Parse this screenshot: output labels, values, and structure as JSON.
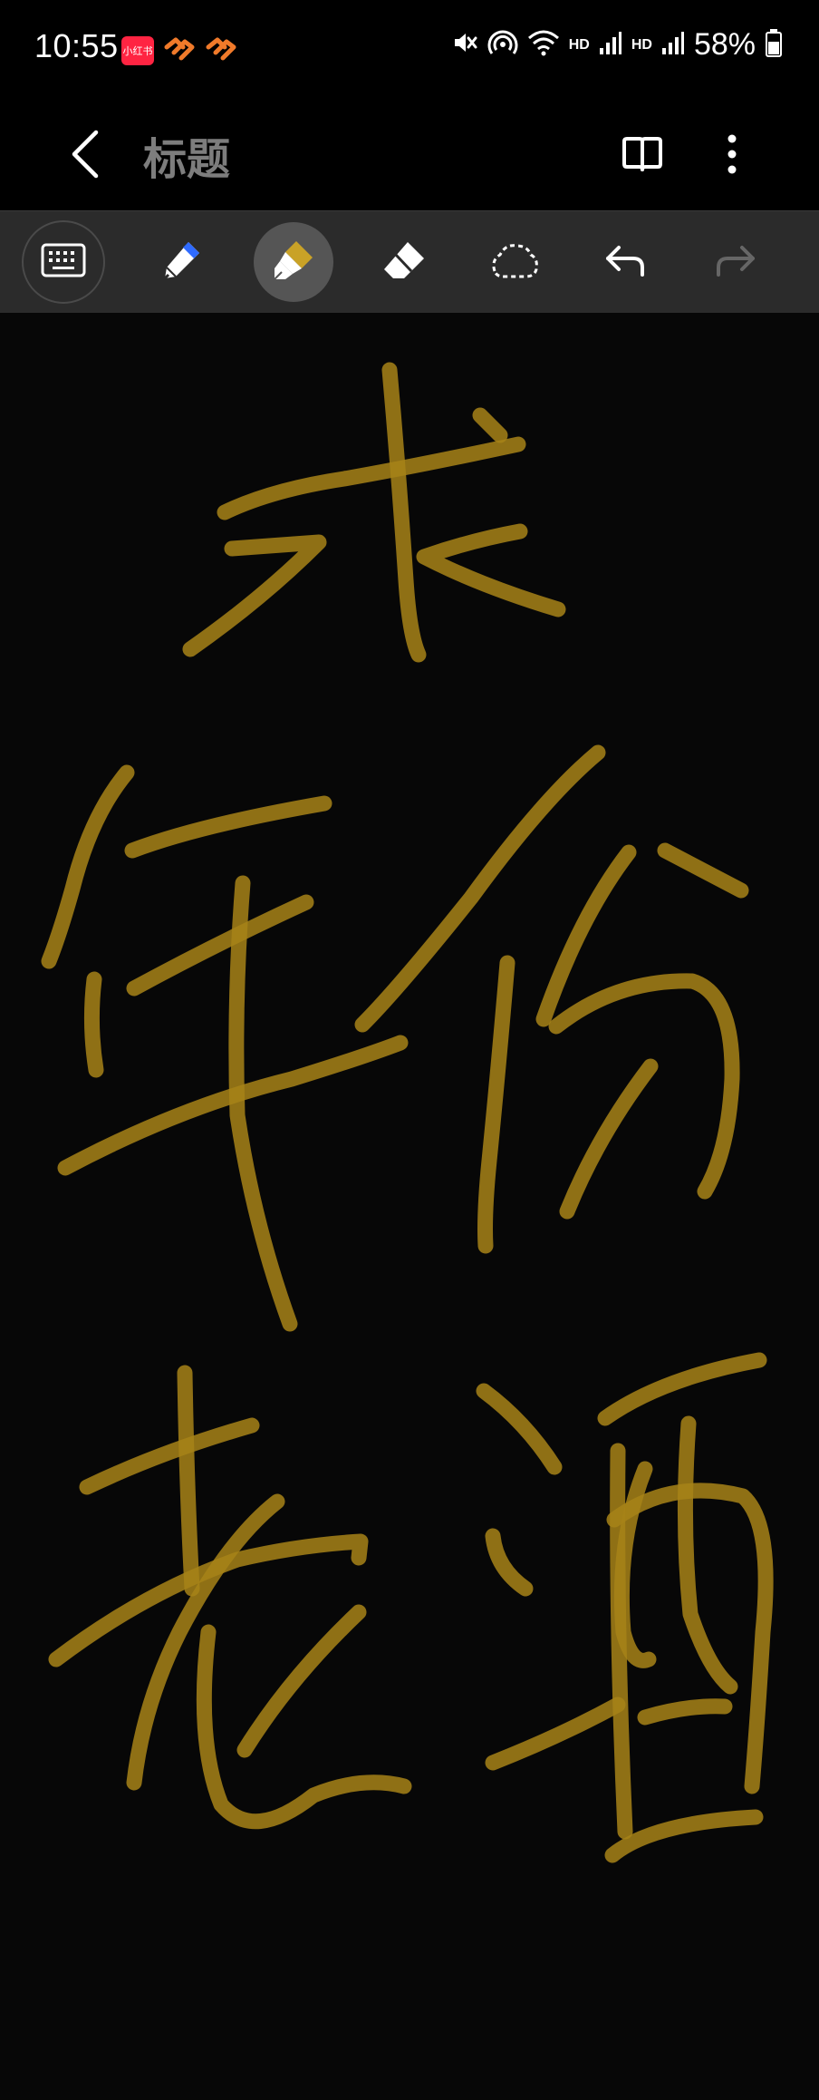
{
  "status_bar": {
    "time": "10:55",
    "notif_badge": "小红书",
    "hd1": "HD",
    "hd2": "HD",
    "battery": "58%"
  },
  "header": {
    "title": "标题"
  },
  "toolbar": {
    "active_tool": "highlighter",
    "tools": [
      "keyboard",
      "pen",
      "highlighter",
      "eraser",
      "lasso",
      "undo",
      "redo"
    ]
  },
  "colors": {
    "highlighter": "#C9A227",
    "pen_tip": "#2F6BFF",
    "toolbar_bg": "#2B2B2B",
    "active_tool_bg": "#555555",
    "title_text": "#7D7D7D"
  },
  "canvas": {
    "ink_color": "#A78217",
    "ink_opacity": 0.85
  }
}
